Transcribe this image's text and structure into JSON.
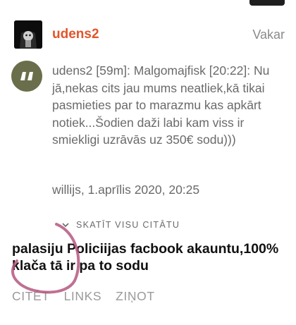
{
  "comment": {
    "username": "udens2",
    "time": "Vakar",
    "quote": {
      "text": "udens2 [59m]: Malgomajfisk [20:22]: Nu jā,nekas cits jau mums neatliek,kā tikai pasmieties par to marazmu kas apkārt notiek...Šodien daži labi kam viss ir smiekligi uzrāvās uz 350€ sodu)))",
      "meta": "willijs, 1.aprīlis 2020, 20:25",
      "view_all_label": "SKATĪT VISU CITĀTU"
    },
    "body": "palasiju Policiijas facbook akauntu,100% klača tā ir pa to sodu",
    "actions": {
      "quote": "CITĒT",
      "links": "LINKS",
      "report": "ZIŅOT"
    }
  },
  "colors": {
    "username": "#e2552b",
    "quote_icon_bg": "#6b6e4a",
    "annotation": "#b5577f"
  },
  "icons": {
    "quote": "quote-icon",
    "chevron": "chevron-down-icon"
  }
}
